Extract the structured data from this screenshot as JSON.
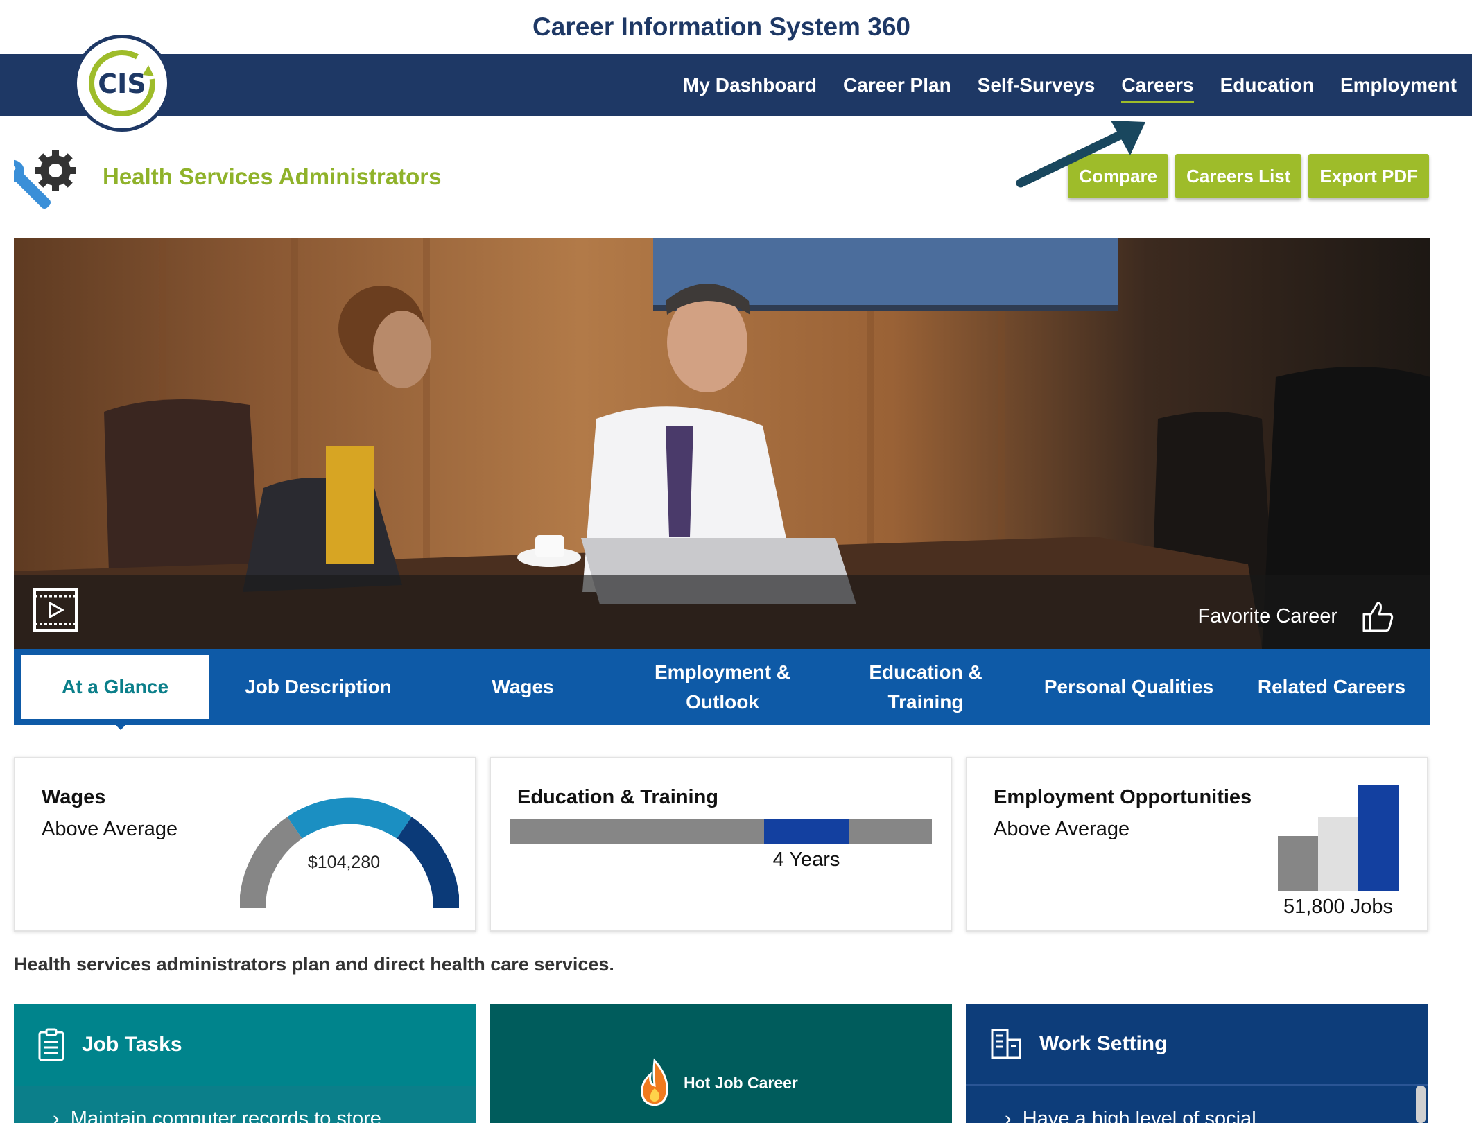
{
  "app": {
    "title": "Career Information System 360"
  },
  "logo": {
    "text": "CIS"
  },
  "nav": {
    "items": [
      {
        "label": "My Dashboard"
      },
      {
        "label": "Career Plan"
      },
      {
        "label": "Self-Surveys"
      },
      {
        "label": "Careers",
        "active": true
      },
      {
        "label": "Education"
      },
      {
        "label": "Employment"
      }
    ]
  },
  "career": {
    "title": "Health Services Administrators"
  },
  "actions": {
    "compare": "Compare",
    "careers_list": "Careers List",
    "export_pdf": "Export PDF"
  },
  "hero": {
    "favorite_label": "Favorite Career"
  },
  "tabs": [
    {
      "label": "At a Glance",
      "active": true
    },
    {
      "label": "Job Description"
    },
    {
      "label": "Wages"
    },
    {
      "line1": "Employment &",
      "line2": "Outlook"
    },
    {
      "line1": "Education &",
      "line2": "Training"
    },
    {
      "label": "Personal Qualities"
    },
    {
      "label": "Related Careers"
    }
  ],
  "cards": {
    "wages": {
      "title": "Wages",
      "level": "Above Average",
      "value": "$104,280",
      "gauge_level": 0.7
    },
    "education": {
      "title": "Education & Training",
      "value": "4 Years"
    },
    "employment": {
      "title": "Employment Opportunities",
      "level": "Above Average",
      "value": "51,800 Jobs"
    }
  },
  "summary": "Health services administrators plan and direct health care services.",
  "bottom": {
    "job_tasks": {
      "title": "Job Tasks",
      "first_item": "Maintain computer records to store"
    },
    "hot_job": {
      "label": "Hot Job Career"
    },
    "work_setting": {
      "title": "Work Setting",
      "first_item": "Have a high level of social"
    }
  },
  "colors": {
    "navy": "#1e3865",
    "green": "#9ebc2a",
    "tab_blue": "#0e5aa7",
    "teal": "#00848c",
    "dark_teal": "#005c5c",
    "deep_blue": "#0d3d7a"
  }
}
